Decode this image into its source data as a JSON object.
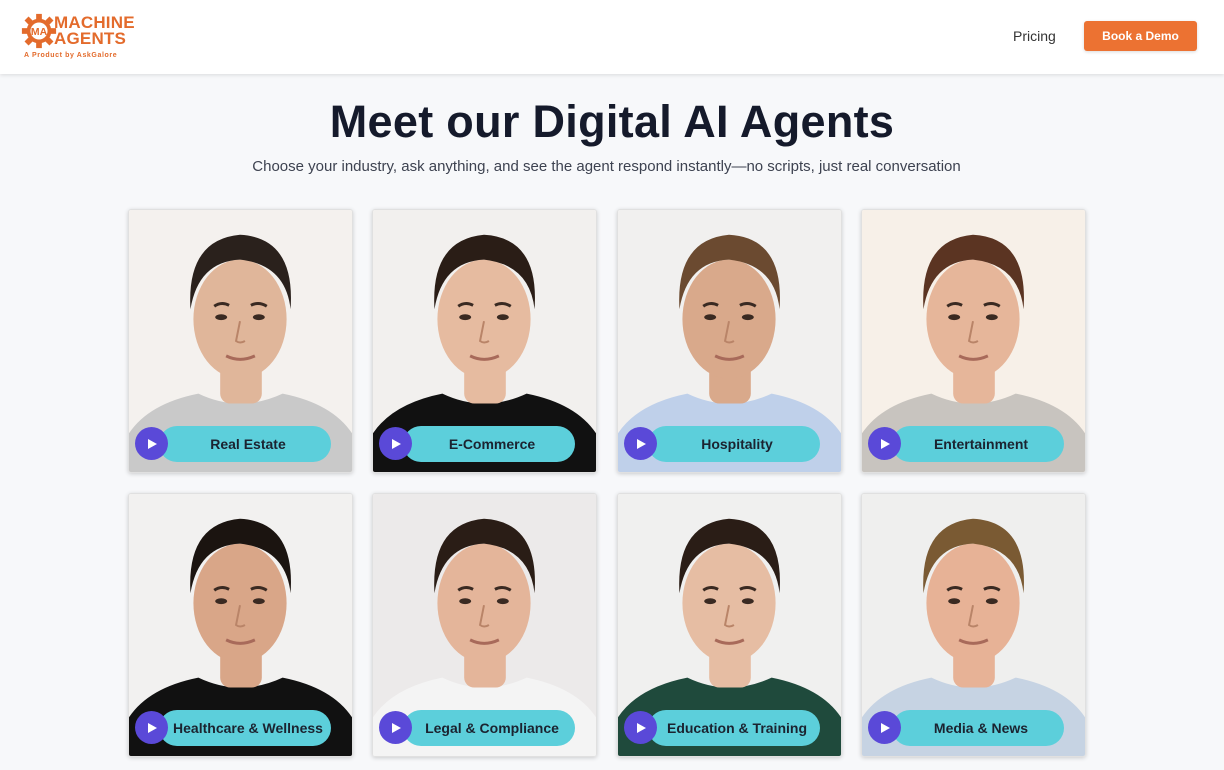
{
  "brand": {
    "name_line1": "MACHINE",
    "name_line2": "AGENTS",
    "tagline": "A Product by AskGalore",
    "logo_mark": "MA",
    "accent_color": "#e36b2c"
  },
  "nav": {
    "pricing_label": "Pricing",
    "demo_label": "Book a Demo"
  },
  "hero": {
    "title": "Meet our Digital AI Agents",
    "subtitle": "Choose your industry, ask anything, and see the agent respond instantly—no scripts, just real conversation"
  },
  "agents": [
    {
      "label": "Real Estate",
      "icon": "play-icon",
      "shirt": "#c9c9c9",
      "hair": "#2a211c",
      "bg": "#f4f1ee",
      "skin": "#e0b69a"
    },
    {
      "label": "E-Commerce",
      "icon": "play-icon",
      "shirt": "#111111",
      "hair": "#2a1d16",
      "bg": "#f2f0ee",
      "skin": "#e6bba0"
    },
    {
      "label": "Hospitality",
      "icon": "play-icon",
      "shirt": "#bfd0ea",
      "hair": "#6b4a30",
      "bg": "#f1f0ef",
      "skin": "#d9a98b"
    },
    {
      "label": "Entertainment",
      "icon": "play-icon",
      "shirt": "#c8c4bf",
      "hair": "#5b3422",
      "bg": "#f7f0e8",
      "skin": "#e6b69a"
    },
    {
      "label": "Healthcare & Wellness",
      "icon": "play-icon",
      "shirt": "#111111",
      "hair": "#1b1410",
      "bg": "#f2f1f0",
      "skin": "#d9a688"
    },
    {
      "label": "Legal & Compliance",
      "icon": "play-icon",
      "shirt": "#f4f4f4",
      "hair": "#2a1d16",
      "bg": "#eceaea",
      "skin": "#e4b59a"
    },
    {
      "label": "Education & Training",
      "icon": "play-icon",
      "shirt": "#1f4a3c",
      "hair": "#2a1d16",
      "bg": "#f0f0ef",
      "skin": "#e6bda3"
    },
    {
      "label": "Media & News",
      "icon": "play-icon",
      "shirt": "#c6d3e3",
      "hair": "#7a5a33",
      "bg": "#efefee",
      "skin": "#e7b296"
    }
  ]
}
